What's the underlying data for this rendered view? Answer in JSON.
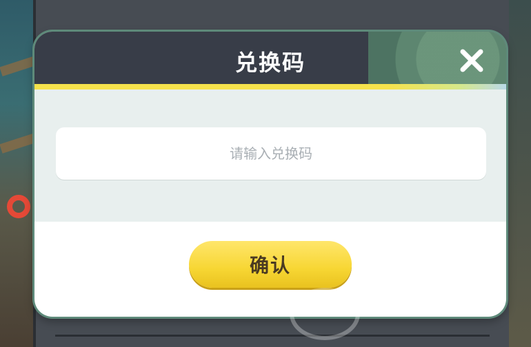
{
  "dialog": {
    "title": "兑换码",
    "input": {
      "placeholder": "请输入兑换码",
      "value": ""
    },
    "confirm_label": "确认",
    "close_icon": "close-x-icon"
  },
  "colors": {
    "header_bg": "#383d48",
    "accent_stripe": "#f5e24c",
    "input_area_bg": "#e8efee",
    "confirm_button": "#f7d633",
    "confirm_text": "#4a3a22"
  }
}
